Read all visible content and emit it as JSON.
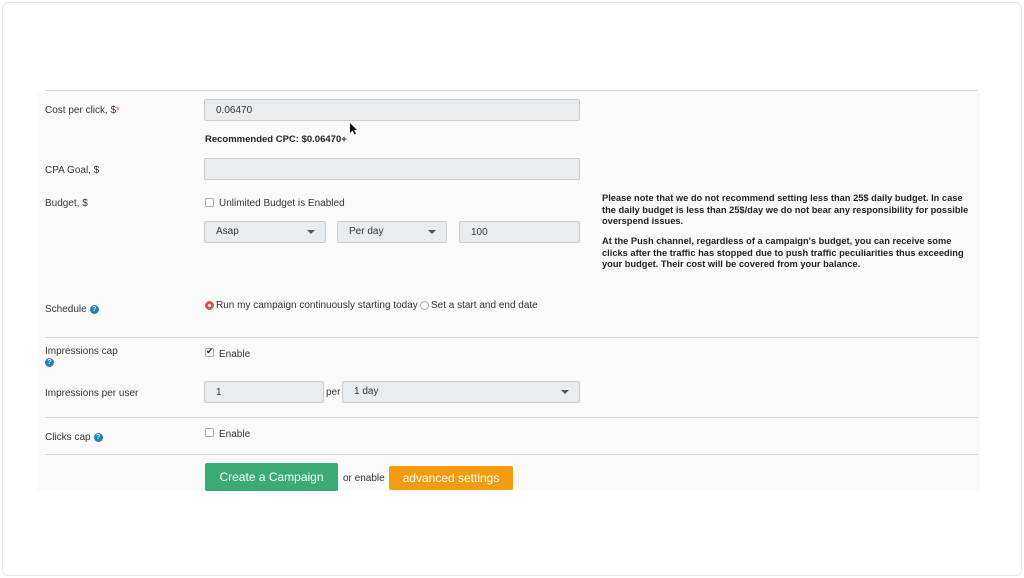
{
  "form": {
    "cpc": {
      "label": "Cost per click, $",
      "required_mark": "*",
      "value": "0.06470",
      "recommended": "Recommended CPC: $0.06470+"
    },
    "cpa_goal": {
      "label": "CPA Goal, $",
      "value": ""
    },
    "budget": {
      "label": "Budget, $",
      "unlimited_label": "Unlimited Budget is Enabled",
      "unlimited_checked": false,
      "pacing": "Asap",
      "period": "Per day",
      "amount": "100"
    },
    "notice": {
      "paragraph1": "Please note that we do not recommend setting less than 25$ daily budget. In case the daily budget is less than 25$/day we do not bear any responsibility for possible overspend issues.",
      "paragraph2": "At the Push channel, regardless of a campaign's budget, you can receive some clicks after the traffic has stopped due to push traffic peculiarities thus exceeding your budget. Their cost will be covered from your balance."
    },
    "schedule": {
      "label": "Schedule",
      "option_continuous": "Run my campaign continuously starting today",
      "option_dates": "Set a start and end date",
      "selected": "continuous"
    },
    "impressions_cap": {
      "label": "Impressions cap",
      "enable_label": "Enable",
      "checked": true
    },
    "impressions_per_user": {
      "label": "Impressions per user",
      "value": "1",
      "per_label": "per",
      "period": "1 day"
    },
    "clicks_cap": {
      "label": "Clicks cap",
      "enable_label": "Enable",
      "checked": false
    },
    "actions": {
      "create_label": "Create a Campaign",
      "or_enable_label": "or enable",
      "advanced_label": "advanced settings"
    },
    "help_glyph": "?",
    "colors": {
      "primary": "#3aab73",
      "accent": "#f39c12",
      "help": "#1f7fbf",
      "required": "#d9534f"
    }
  }
}
